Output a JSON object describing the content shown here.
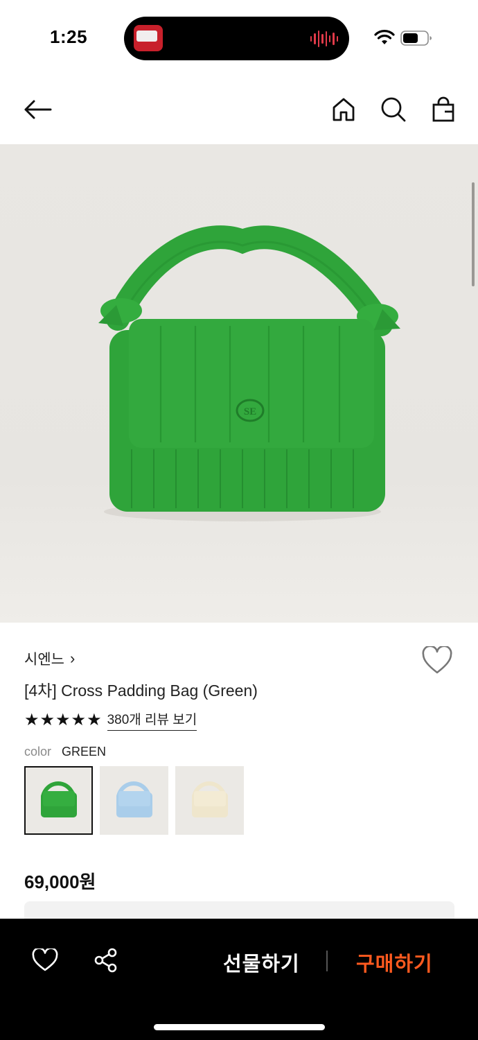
{
  "status_bar": {
    "time": "1:25"
  },
  "header": {
    "back_icon": "arrow-left-icon",
    "home_icon": "home-icon",
    "search_icon": "search-icon",
    "cart_icon": "shopping-bag-icon"
  },
  "product": {
    "brand": "시엔느",
    "brand_chevron": "›",
    "title": "[4차] Cross Padding Bag (Green)",
    "rating_stars": 5,
    "review_link": "380개 리뷰 보기",
    "color_label": "color",
    "color_value": "GREEN",
    "swatches": [
      {
        "name": "green",
        "color": "#2fa43a",
        "selected": true
      },
      {
        "name": "light-blue",
        "color": "#a9cdea",
        "selected": false
      },
      {
        "name": "cream",
        "color": "#efe6cc",
        "selected": false
      }
    ],
    "price": "69,000원",
    "bag_color": "#2fa43a"
  },
  "bottom_bar": {
    "wishlist_icon": "heart-icon",
    "share_icon": "share-icon",
    "gift_label": "선물하기",
    "buy_label": "구매하기",
    "buy_color": "#ff5a1f"
  }
}
